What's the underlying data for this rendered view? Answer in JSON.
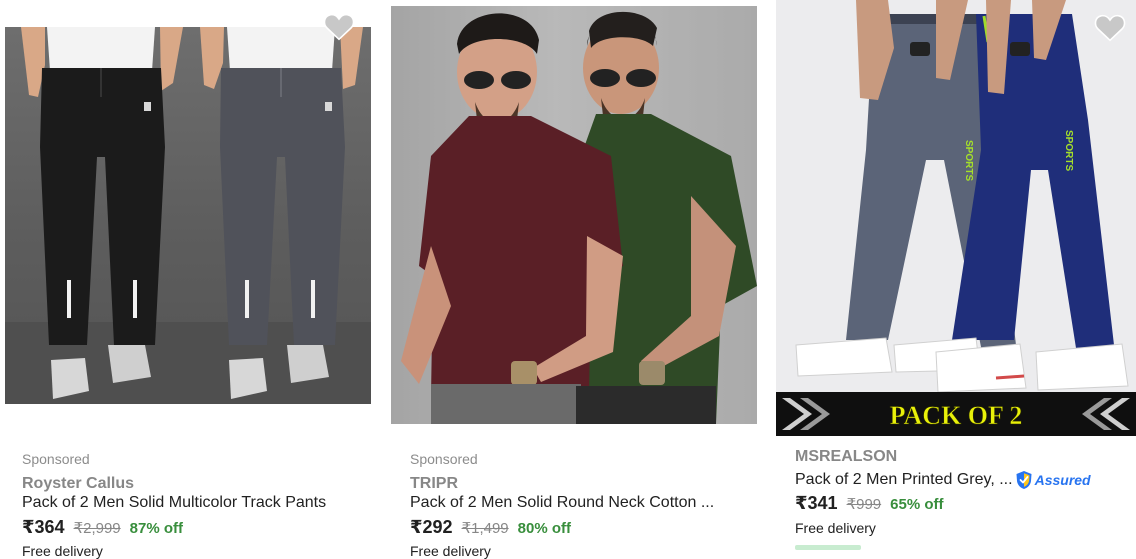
{
  "products": [
    {
      "sponsored": "Sponsored",
      "brand": "Royster Callus",
      "title": "Pack of 2 Men Solid Multicolor Track Pants",
      "price": "₹364",
      "mrp": "₹2,999",
      "discount": "87% off",
      "delivery": "Free delivery",
      "image": "two-models-black-grey-track-pants",
      "wishlist_icon": "heart-icon"
    },
    {
      "sponsored": "Sponsored",
      "brand": "TRIPR",
      "title": "Pack of 2 Men Solid Round Neck Cotton ...",
      "price": "₹292",
      "mrp": "₹1,499",
      "discount": "80% off",
      "delivery": "Free delivery",
      "image": "two-models-maroon-green-tshirts"
    },
    {
      "brand": "MSREALSON",
      "title": "Pack of 2 Men Printed Grey, ...",
      "assured_label": "Assured",
      "price": "₹341",
      "mrp": "₹999",
      "discount": "65% off",
      "delivery": "Free delivery",
      "image": "two-models-grey-navy-track-pants",
      "banner_text": "PACK OF 2",
      "sports_print": "SPORTS",
      "wishlist_icon": "heart-icon"
    }
  ],
  "colors": {
    "discount_green": "#388e3c",
    "assured_blue": "#2874f0",
    "banner_yellow": "#e9f10a"
  }
}
